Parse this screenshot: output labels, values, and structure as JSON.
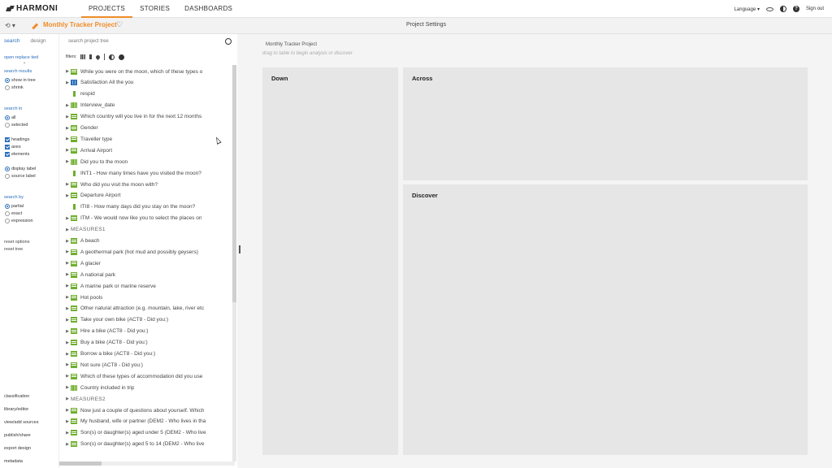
{
  "brand": "HARMONI",
  "nav": [
    "PROJECTS",
    "STORIES",
    "DASHBOARDS"
  ],
  "top_right": {
    "language": "Language ▾",
    "signout": "Sign out",
    "help": "?"
  },
  "secbar": {
    "project_name": "Monthly Tracker Project",
    "page_title": "Project Settings",
    "undo": "⟲ ▾",
    "heart": "♡"
  },
  "left": {
    "tabs": [
      "search",
      "design"
    ],
    "open_replace": "open replace tied",
    "search_results_label": "search results",
    "search_results_opts": [
      "show in tree",
      "shrink"
    ],
    "search_in_label": "search in",
    "search_in_opts": [
      "all",
      "selected"
    ],
    "checks": [
      "headings",
      "axes",
      "elements"
    ],
    "label_opts": [
      "display label",
      "source label"
    ],
    "search_by_label": "search by",
    "search_by_opts": [
      "partial",
      "exact",
      "expression"
    ],
    "reset_options": "reset options",
    "reset_tree": "reset tree",
    "bottom_links": [
      "classification",
      "library/editor",
      "view/add sources",
      "publish/share",
      "export design",
      "metadata"
    ]
  },
  "tree": {
    "search_placeholder": "search project tree",
    "filters_label": "filters:",
    "rows": [
      {
        "label": "While you were on the moon, which of these types o",
        "icon": "list",
        "caret": true
      },
      {
        "label": "Satisfaction All the you",
        "icon": "gridblue",
        "caret": true
      },
      {
        "label": "respid",
        "icon": "thin",
        "caret": false
      },
      {
        "label": "Interview_date",
        "icon": "grid",
        "caret": true
      },
      {
        "label": "Which country will you live in for the next 12 months",
        "icon": "list",
        "caret": true
      },
      {
        "label": "Gender",
        "icon": "list",
        "caret": true
      },
      {
        "label": "Traveller type",
        "icon": "list",
        "caret": true
      },
      {
        "label": "Arrival Airport",
        "icon": "list",
        "caret": true
      },
      {
        "label": "Did you to the moon",
        "icon": "grid",
        "caret": true
      },
      {
        "label": "INT1 - How many times have you visited the moon?",
        "icon": "thin",
        "caret": false
      },
      {
        "label": "Who did you visit the moon with?",
        "icon": "list",
        "caret": true
      },
      {
        "label": "Departure Airport",
        "icon": "list",
        "caret": true
      },
      {
        "label": "ITI8 - How many days did you stay on the moon?",
        "icon": "thin",
        "caret": false
      },
      {
        "label": "ITM - We would now like you to select the places on",
        "icon": "list",
        "caret": true
      },
      {
        "label": "MEASURES1",
        "icon": "none",
        "caret": true,
        "heading": true
      },
      {
        "label": "A beach",
        "icon": "list",
        "caret": true
      },
      {
        "label": "A geothermal park (hot mud and possibly geysers)",
        "icon": "list",
        "caret": true
      },
      {
        "label": "A glacier",
        "icon": "list",
        "caret": true
      },
      {
        "label": "A national park",
        "icon": "list",
        "caret": true
      },
      {
        "label": "A marine park or marine reserve",
        "icon": "list",
        "caret": true
      },
      {
        "label": "Hot pools",
        "icon": "list",
        "caret": true
      },
      {
        "label": "Other natural attraction (e.g. mountain, lake, river etc",
        "icon": "list",
        "caret": true
      },
      {
        "label": "Take your own bike (ACT8 - Did you:)",
        "icon": "list",
        "caret": true
      },
      {
        "label": "Hire a bike (ACT8 - Did you:)",
        "icon": "list",
        "caret": true
      },
      {
        "label": "Buy a bike (ACT8 - Did you:)",
        "icon": "list",
        "caret": true
      },
      {
        "label": "Borrow a bike (ACT8 - Did you:)",
        "icon": "list",
        "caret": true
      },
      {
        "label": "Not sure (ACT8 - Did you:)",
        "icon": "list",
        "caret": true
      },
      {
        "label": "Which of these types of accommodation did you use",
        "icon": "list",
        "caret": true
      },
      {
        "label": "Country included in trip",
        "icon": "grid",
        "caret": true
      },
      {
        "label": "MEASURES2",
        "icon": "none",
        "caret": true,
        "heading": true
      },
      {
        "label": "Now just a couple of questions about yourself. Which",
        "icon": "list",
        "caret": true
      },
      {
        "label": "My husband, wife or partner (DEM2 - Who lives in tha",
        "icon": "list",
        "caret": true
      },
      {
        "label": "Son(s) or daughter(s) aged under 5 (DEM2 - Who live",
        "icon": "list",
        "caret": true
      },
      {
        "label": "Son(s) or daughter(s) aged 5 to 14 (DEM2 - Who live",
        "icon": "list",
        "caret": true
      }
    ]
  },
  "main": {
    "title": "Monthly Tracker Project",
    "hint": "drag to table to begin analysis or discover",
    "zones": [
      "Down",
      "Across",
      "Discover"
    ]
  }
}
